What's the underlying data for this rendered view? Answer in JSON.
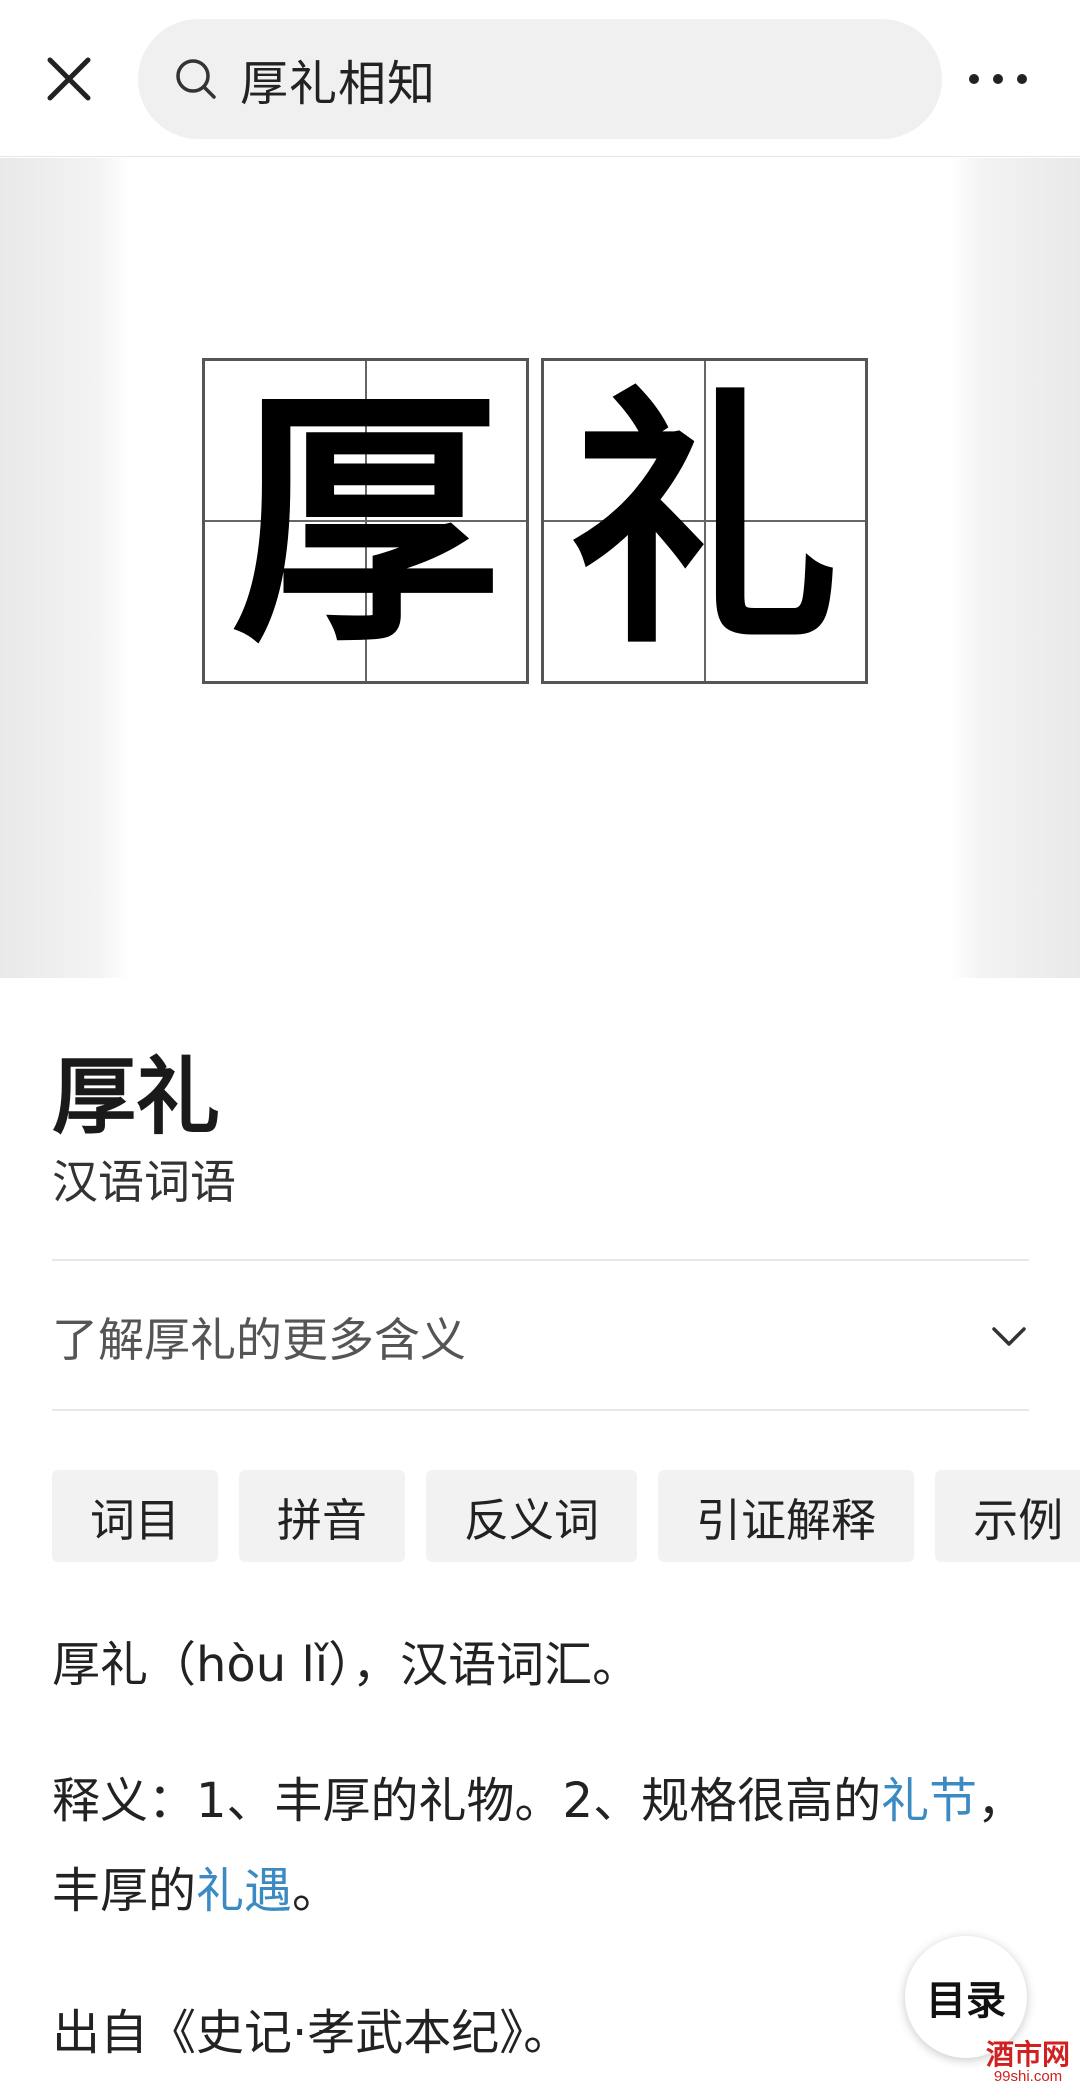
{
  "topbar": {
    "close_icon": "close-icon",
    "search_icon": "search-icon",
    "search_query": "厚礼相知",
    "more_icon": "more-horizontal-icon"
  },
  "hero": {
    "chars": [
      "厚",
      "礼"
    ]
  },
  "entry": {
    "title": "厚礼",
    "subtitle": "汉语词语"
  },
  "more_meanings": {
    "label": "了解厚礼的更多含义",
    "icon": "chevron-down-icon"
  },
  "tabs": [
    {
      "label": "词目"
    },
    {
      "label": "拼音"
    },
    {
      "label": "反义词"
    },
    {
      "label": "引证解释"
    },
    {
      "label": "示例"
    }
  ],
  "content": {
    "p1": "厚礼（hòu lǐ），汉语词汇。",
    "p2_prefix": "释义：1、丰厚的礼物。2、规格很高的",
    "p2_link1": "礼节",
    "p2_mid": "，丰厚的",
    "p2_link2": "礼遇",
    "p2_end": "。",
    "p3": "出自《史记·孝武本纪》。"
  },
  "toc": {
    "label": "目录"
  },
  "watermark": {
    "main": "酒市网",
    "sub": "99shi.com"
  },
  "colors": {
    "link": "#3b8ac2",
    "search_bg": "#f0f0f0",
    "tab_bg": "#f2f2f2",
    "watermark": "#d12020"
  }
}
